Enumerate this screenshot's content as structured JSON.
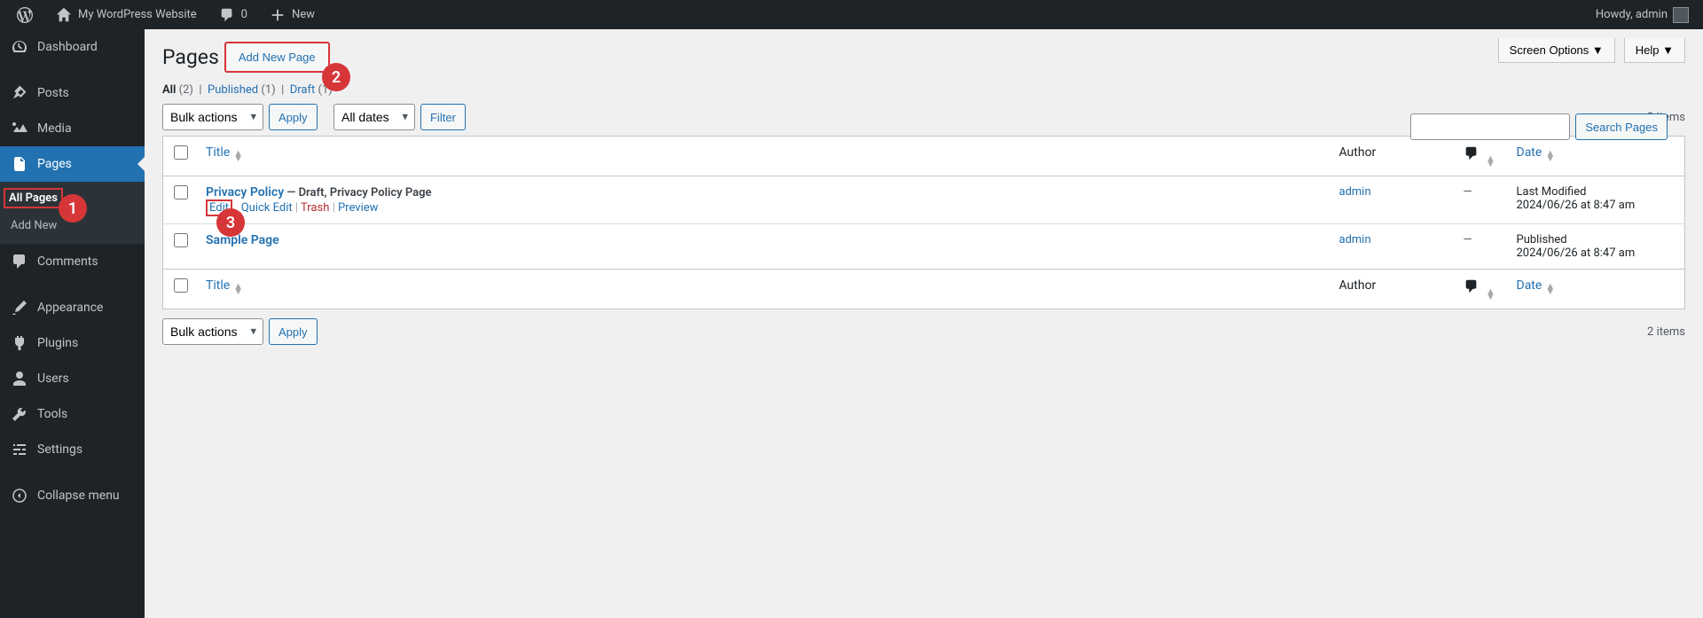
{
  "adminBar": {
    "siteName": "My WordPress Website",
    "commentsCount": "0",
    "newLabel": "New",
    "greeting": "Howdy, admin"
  },
  "sidebar": {
    "dashboard": "Dashboard",
    "posts": "Posts",
    "media": "Media",
    "pages": "Pages",
    "pagesSubmenu": {
      "all": "All Pages",
      "addNew": "Add New"
    },
    "comments": "Comments",
    "appearance": "Appearance",
    "plugins": "Plugins",
    "users": "Users",
    "tools": "Tools",
    "settings": "Settings",
    "collapse": "Collapse menu"
  },
  "screenButtons": {
    "options": "Screen Options",
    "help": "Help"
  },
  "header": {
    "title": "Pages",
    "addNew": "Add New Page"
  },
  "filters": {
    "allLabel": "All",
    "allCount": "(2)",
    "publishedLabel": "Published",
    "publishedCount": "(1)",
    "draftLabel": "Draft",
    "draftCount": "(1)"
  },
  "bulk": {
    "label": "Bulk actions",
    "apply": "Apply"
  },
  "dateFilter": {
    "label": "All dates",
    "filterBtn": "Filter"
  },
  "search": {
    "button": "Search Pages"
  },
  "itemsCount": "2 items",
  "table": {
    "cols": {
      "title": "Title",
      "author": "Author",
      "date": "Date"
    },
    "rows": [
      {
        "title": "Privacy Policy",
        "stateText": " — Draft, Privacy Policy Page",
        "author": "admin",
        "commentsDisplay": "—",
        "dateLabel": "Last Modified",
        "dateValue": "2024/06/26 at 8:47 am",
        "showActions": true
      },
      {
        "title": "Sample Page",
        "stateText": "",
        "author": "admin",
        "commentsDisplay": "—",
        "dateLabel": "Published",
        "dateValue": "2024/06/26 at 8:47 am",
        "showActions": false
      }
    ],
    "rowActions": {
      "edit": "Edit",
      "quickEdit": "Quick Edit",
      "trash": "Trash",
      "preview": "Preview"
    }
  },
  "annotations": {
    "n1": "1",
    "n2": "2",
    "n3": "3"
  }
}
